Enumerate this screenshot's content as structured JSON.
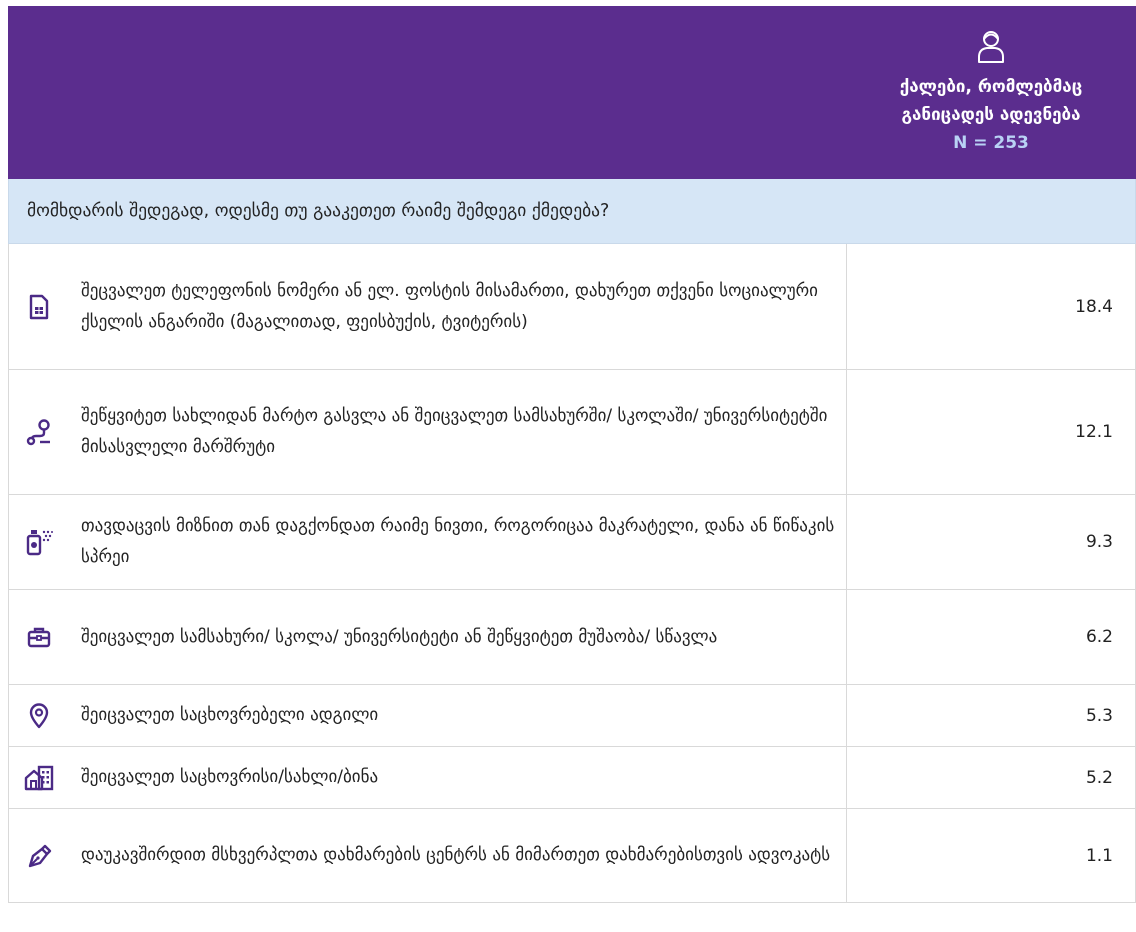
{
  "header": {
    "column_title": "ქალები, რომლებმაც განიცადეს ადევნება",
    "n_label": "N = 253",
    "icon": "person-icon"
  },
  "question": "მომხდარის შედეგად, ოდესმე თუ გააკეთეთ რაიმე შემდეგი ქმედება?",
  "colors": {
    "header_bg": "#5b2d8e",
    "question_bg": "#d6e6f6",
    "icon_color": "#4b2a86",
    "n_color": "#b9d2f5"
  },
  "rows": [
    {
      "icon": "sim-card-icon",
      "label": "შეცვალეთ ტელეფონის ნომერი ან ელ. ფოსტის მისამართი, დახურეთ თქვენი სოციალური ქსელის ანგარიში (მაგალითად, ფეისბუქის, ტვიტერის)",
      "value": "18.4"
    },
    {
      "icon": "route-icon",
      "label": "შეწყვიტეთ სახლიდან მარტო გასვლა ან შეიცვალეთ სამსახურში/ სკოლაში/ უნივერსიტეტში მისასვლელი მარშრუტი",
      "value": "12.1"
    },
    {
      "icon": "spray-icon",
      "label": "თავდაცვის მიზნით თან დაგქონდათ რაიმე ნივთი, როგორიცაა მაკრატელი, დანა ან წიწაკის სპრეი",
      "value": "9.3"
    },
    {
      "icon": "briefcase-icon",
      "label": "შეიცვალეთ სამსახური/ სკოლა/ უნივერსიტეტი ან შეწყვიტეთ მუშაობა/ სწავლა",
      "value": "6.2"
    },
    {
      "icon": "location-pin-icon",
      "label": "შეიცვალეთ საცხოვრებელი ადგილი",
      "value": "5.3"
    },
    {
      "icon": "home-building-icon",
      "label": "შეიცვალეთ საცხოვრისი/სახლი/ბინა",
      "value": "5.2"
    },
    {
      "icon": "pen-icon",
      "label": "დაუკავშირდით მსხვერპლთა დახმარების ცენტრს ან მიმართეთ დახმარებისთვის ადვოკატს",
      "value": "1.1"
    }
  ]
}
